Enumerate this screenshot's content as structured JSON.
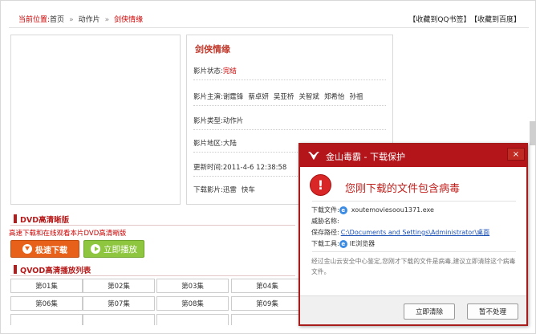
{
  "breadcrumb": {
    "label": "当前位置:",
    "home": "首页",
    "sep": "»",
    "category": "动作片",
    "current": "剑侠情缘"
  },
  "favorites": [
    "【收藏到QQ书签】",
    "【收藏到百度】"
  ],
  "info": {
    "title": "剑侠情缘",
    "status_label": "影片状态:",
    "status_value": "完结",
    "cast_label": "影片主演:",
    "cast": [
      "谢霆锋",
      "蔡卓妍",
      "吴亚桥",
      "关智斌",
      "郑希怡",
      "孙祖"
    ],
    "type_label": "影片类型:",
    "type_value": "动作片",
    "region_label": "影片地区:",
    "region_value": "大陆",
    "updated_label": "更新时间:",
    "updated_value": "2011-4-6 12:38:58",
    "download_label": "下载影片:",
    "download_value": "迅雷",
    "download_value2": "快车"
  },
  "dvd": {
    "title": "DVD高清晰版",
    "subtitle": "高速下载和在线观看本片DVD高清晰版",
    "fast_download": "极速下载",
    "play_now": "立即播放"
  },
  "qvod": {
    "title": "QVOD高清播放列表",
    "episodes": [
      "第01集",
      "第02集",
      "第03集",
      "第04集",
      "第06集",
      "第07集",
      "第08集",
      "第09集"
    ]
  },
  "dialog": {
    "title": "金山毒霸 - 下载保护",
    "close": "×",
    "heading": "您刚下载的文件包含病毒",
    "file_label": "下载文件:",
    "file_value": "xoutemoviesoou1371.exe",
    "threat_label": "威胁名称:",
    "path_label": "保存路径:",
    "path_value": "C:\\Documents and Settings\\Administrator\\桌面",
    "tool_label": "下载工具:",
    "tool_value": "IE浏览器",
    "note": "经过金山云安全中心鉴定,您刚才下载的文件是病毒,建议立即清除这个病毒文件。",
    "btn_clear": "立即清除",
    "btn_ignore": "暂不处理"
  },
  "colors": {
    "accent": "#b3151b",
    "orange": "#e8611a",
    "green": "#8ec63f",
    "link": "#1a4fb4"
  }
}
